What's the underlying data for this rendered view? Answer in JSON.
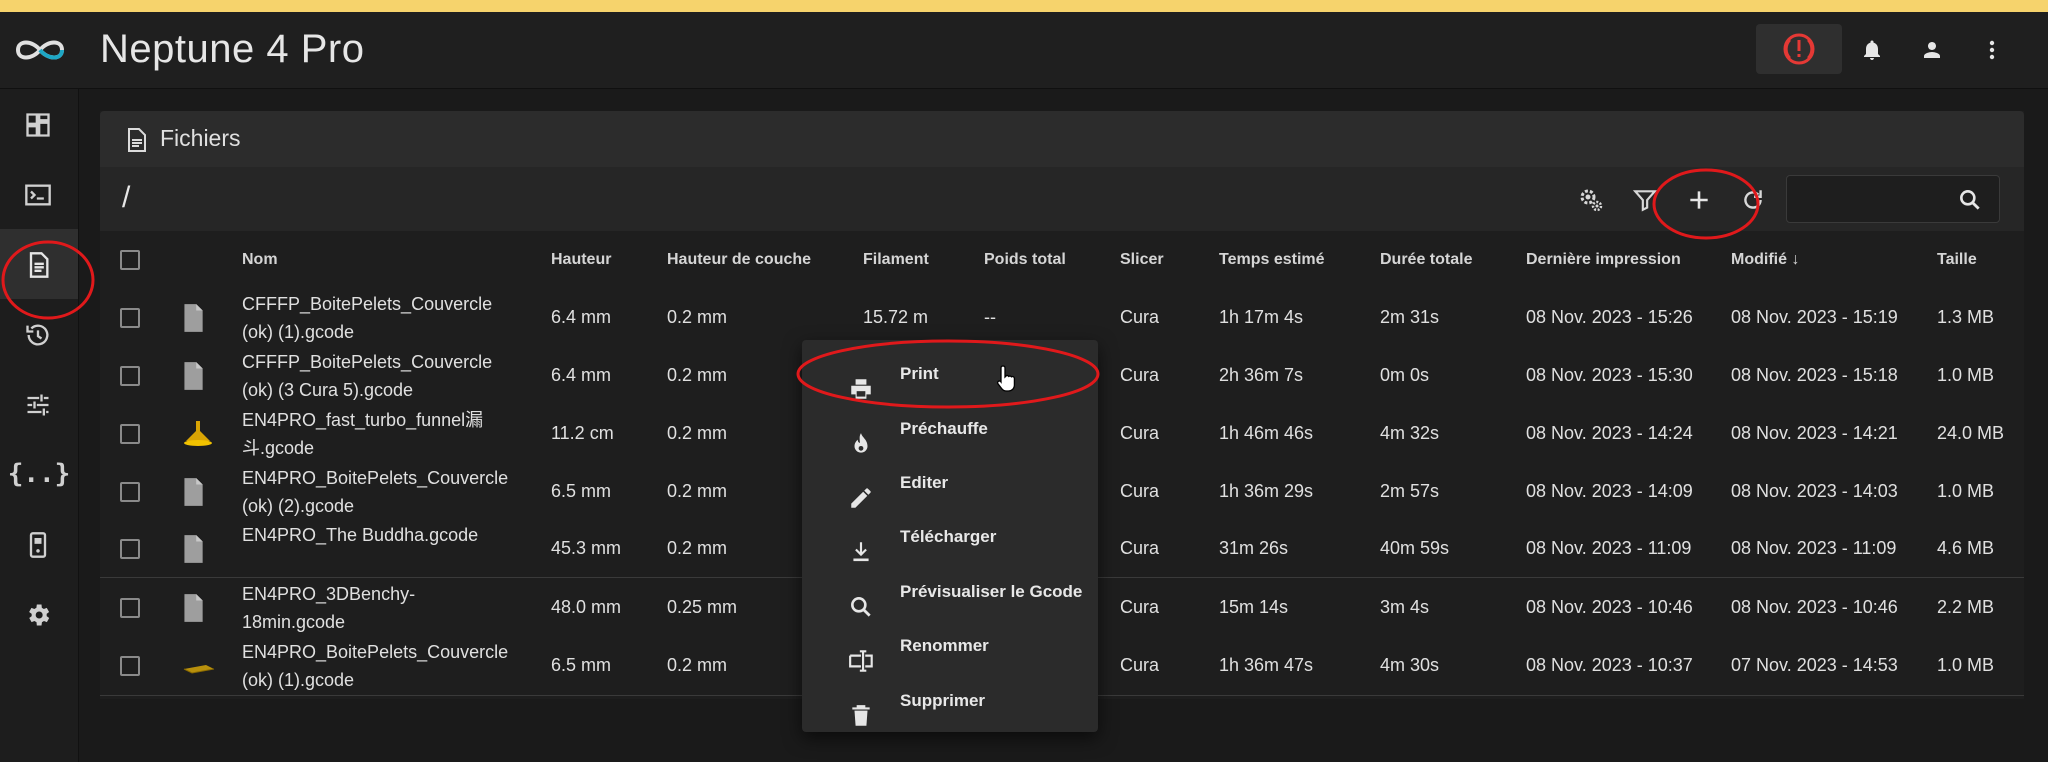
{
  "app": {
    "title": "Neptune 4 Pro"
  },
  "page": {
    "title": "Fichiers",
    "path": "/",
    "search_placeholder": ""
  },
  "columns": [
    "Nom",
    "Hauteur",
    "Hauteur de couche",
    "Filament",
    "Poids total",
    "Slicer",
    "Temps estimé",
    "Durée totale",
    "Dernière impression",
    "Modifié",
    "Taille"
  ],
  "sort_indicator": "↓",
  "rows": [
    {
      "name": "CFFFP_BoitePelets_Couvercle (ok) (1).gcode",
      "thumb": "file-icon",
      "height": "6.4 mm",
      "layer": "0.2 mm",
      "filament": "15.72 m",
      "weight": "--",
      "slicer": "Cura",
      "est": "1h 17m 4s",
      "total": "2m 31s",
      "last": "08 Nov. 2023 - 15:26",
      "modified": "08 Nov. 2023 - 15:19",
      "size": "1.3 MB"
    },
    {
      "name": "CFFFP_BoitePelets_Couvercle (ok) (3 Cura 5).gcode",
      "thumb": "file-icon",
      "height": "6.4 mm",
      "layer": "0.2 mm",
      "filament": "",
      "weight": "",
      "slicer": "Cura",
      "est": "2h 36m 7s",
      "total": "0m 0s",
      "last": "08 Nov. 2023 - 15:30",
      "modified": "08 Nov. 2023 - 15:18",
      "size": "1.0 MB"
    },
    {
      "name": "EN4PRO_fast_turbo_funnel漏斗.gcode",
      "thumb": "funnel-thumbnail",
      "height": "11.2 cm",
      "layer": "0.2 mm",
      "filament": "",
      "weight": "",
      "slicer": "Cura",
      "est": "1h 46m 46s",
      "total": "4m 32s",
      "last": "08 Nov. 2023 - 14:24",
      "modified": "08 Nov. 2023 - 14:21",
      "size": "24.0 MB"
    },
    {
      "name": "EN4PRO_BoitePelets_Couvercle (ok) (2).gcode",
      "thumb": "file-icon",
      "height": "6.5 mm",
      "layer": "0.2 mm",
      "filament": "",
      "weight": "",
      "slicer": "Cura",
      "est": "1h 36m 29s",
      "total": "2m 57s",
      "last": "08 Nov. 2023 - 14:09",
      "modified": "08 Nov. 2023 - 14:03",
      "size": "1.0 MB"
    },
    {
      "name": "EN4PRO_The Buddha.gcode",
      "thumb": "file-icon",
      "height": "45.3 mm",
      "layer": "0.2 mm",
      "filament": "",
      "weight": "",
      "slicer": "Cura",
      "est": "31m 26s",
      "total": "40m 59s",
      "last": "08 Nov. 2023 - 11:09",
      "modified": "08 Nov. 2023 - 11:09",
      "size": "4.6 MB"
    },
    {
      "name": "EN4PRO_3DBenchy-18min.gcode",
      "thumb": "file-icon",
      "height": "48.0 mm",
      "layer": "0.25 mm",
      "filament": "",
      "weight": "",
      "slicer": "Cura",
      "est": "15m 14s",
      "total": "3m 4s",
      "last": "08 Nov. 2023 - 10:46",
      "modified": "08 Nov. 2023 - 10:46",
      "size": "2.2 MB"
    },
    {
      "name": "EN4PRO_BoitePelets_Couvercle (ok) (1).gcode",
      "thumb": "plate-thumbnail",
      "height": "6.5 mm",
      "layer": "0.2 mm",
      "filament": "",
      "weight": "",
      "slicer": "Cura",
      "est": "1h 36m 47s",
      "total": "4m 30s",
      "last": "08 Nov. 2023 - 10:37",
      "modified": "07 Nov. 2023 - 14:53",
      "size": "1.0 MB"
    }
  ],
  "context_menu": {
    "items": [
      {
        "label": "Print",
        "icon": "printer-icon"
      },
      {
        "label": "Préchauffe",
        "icon": "fire-icon"
      },
      {
        "label": "Editer",
        "icon": "pencil-icon"
      },
      {
        "label": "Télécharger",
        "icon": "download-icon"
      },
      {
        "label": "Prévisualiser le Gcode",
        "icon": "magnify-icon"
      },
      {
        "label": "Renommer",
        "icon": "rename-icon"
      },
      {
        "label": "Supprimer",
        "icon": "trash-icon"
      }
    ]
  },
  "sidebar": {
    "items": [
      "dashboard-icon",
      "console-icon",
      "files-icon",
      "history-icon",
      "tune-icon",
      "config-braces-icon",
      "device-icon",
      "settings-icon"
    ],
    "active": "files-icon",
    "braces_glyph": "{..}"
  },
  "colors": {
    "accent_strip": "#f6d36c",
    "annotation_red": "#e0191b",
    "emergency_red": "#e53935"
  }
}
